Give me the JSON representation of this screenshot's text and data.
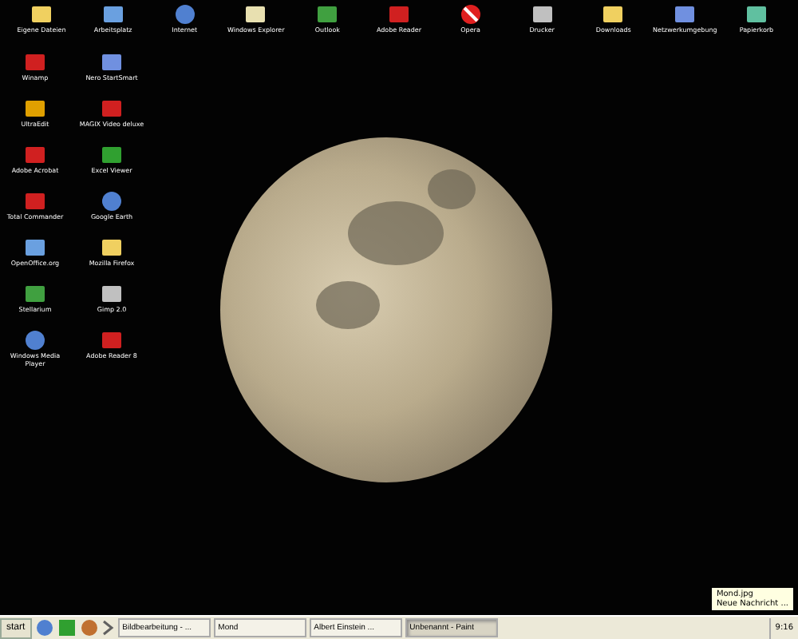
{
  "desktop": {
    "top_icons": [
      {
        "label": "Eigene Dateien",
        "kind": "folder"
      },
      {
        "label": "Arbeitsplatz",
        "kind": "computer"
      },
      {
        "label": "Internet",
        "kind": "globe"
      },
      {
        "label": "Windows Explorer",
        "kind": "explorer"
      },
      {
        "label": "Outlook",
        "kind": "windows"
      },
      {
        "label": "Adobe Reader",
        "kind": "red"
      },
      {
        "label": "Opera",
        "kind": "forbidden"
      },
      {
        "label": "Drucker",
        "kind": "printer"
      },
      {
        "label": "Downloads",
        "kind": "folder"
      },
      {
        "label": "Netzwerkumgebung",
        "kind": "network"
      },
      {
        "label": "Papierkorb",
        "kind": "bin"
      }
    ],
    "left_icons": [
      {
        "label": "Winamp",
        "kind": "red"
      },
      {
        "label": "Nero StartSmart",
        "kind": "network"
      },
      {
        "label": "UltraEdit",
        "kind": "lp"
      },
      {
        "label": "MAGIX Video deluxe",
        "kind": "red"
      },
      {
        "label": "Adobe Acrobat",
        "kind": "red"
      },
      {
        "label": "Excel Viewer",
        "kind": "green"
      },
      {
        "label": "Total Commander",
        "kind": "red"
      },
      {
        "label": "Google Earth",
        "kind": "globe"
      },
      {
        "label": "OpenOffice.org",
        "kind": "computer"
      },
      {
        "label": "Mozilla Firefox",
        "kind": "folder"
      },
      {
        "label": "Stellarium",
        "kind": "windows"
      },
      {
        "label": "Gimp 2.0",
        "kind": "printer"
      },
      {
        "label": "Windows Media Player",
        "kind": "globe"
      },
      {
        "label": "Adobe Reader 8",
        "kind": "red"
      }
    ]
  },
  "taskbar": {
    "start": "start",
    "tasks": [
      {
        "label": "Bildbearbeitung - ...",
        "selected": false
      },
      {
        "label": "Mond",
        "selected": false
      },
      {
        "label": "Albert Einstein ...",
        "selected": false
      },
      {
        "label": "Unbenannt - Paint",
        "selected": true
      }
    ],
    "clock": "9:16",
    "tooltip": [
      "Mond.jpg",
      "Neue Nachricht ..."
    ]
  }
}
